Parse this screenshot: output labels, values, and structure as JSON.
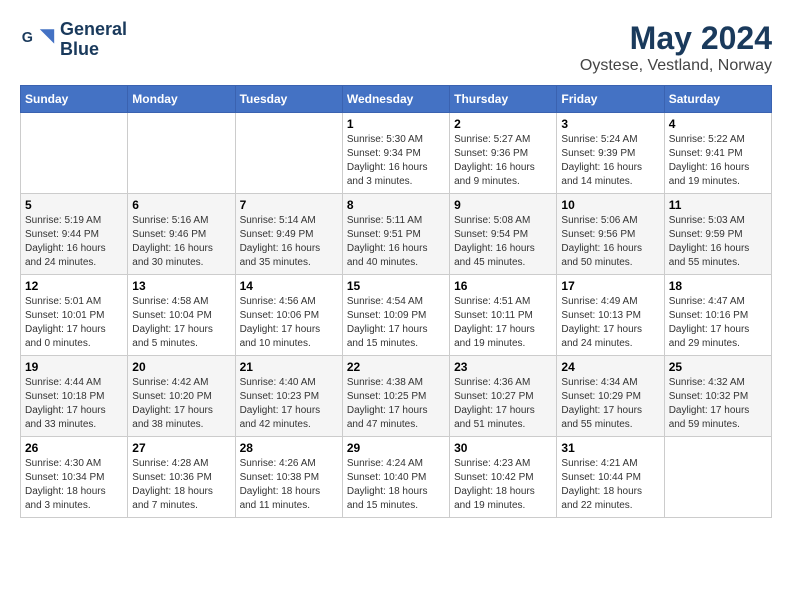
{
  "header": {
    "logo_line1": "General",
    "logo_line2": "Blue",
    "title": "May 2024",
    "subtitle": "Oystese, Vestland, Norway"
  },
  "weekdays": [
    "Sunday",
    "Monday",
    "Tuesday",
    "Wednesday",
    "Thursday",
    "Friday",
    "Saturday"
  ],
  "weeks": [
    [
      {
        "day": "",
        "info": ""
      },
      {
        "day": "",
        "info": ""
      },
      {
        "day": "",
        "info": ""
      },
      {
        "day": "1",
        "info": "Sunrise: 5:30 AM\nSunset: 9:34 PM\nDaylight: 16 hours\nand 3 minutes."
      },
      {
        "day": "2",
        "info": "Sunrise: 5:27 AM\nSunset: 9:36 PM\nDaylight: 16 hours\nand 9 minutes."
      },
      {
        "day": "3",
        "info": "Sunrise: 5:24 AM\nSunset: 9:39 PM\nDaylight: 16 hours\nand 14 minutes."
      },
      {
        "day": "4",
        "info": "Sunrise: 5:22 AM\nSunset: 9:41 PM\nDaylight: 16 hours\nand 19 minutes."
      }
    ],
    [
      {
        "day": "5",
        "info": "Sunrise: 5:19 AM\nSunset: 9:44 PM\nDaylight: 16 hours\nand 24 minutes."
      },
      {
        "day": "6",
        "info": "Sunrise: 5:16 AM\nSunset: 9:46 PM\nDaylight: 16 hours\nand 30 minutes."
      },
      {
        "day": "7",
        "info": "Sunrise: 5:14 AM\nSunset: 9:49 PM\nDaylight: 16 hours\nand 35 minutes."
      },
      {
        "day": "8",
        "info": "Sunrise: 5:11 AM\nSunset: 9:51 PM\nDaylight: 16 hours\nand 40 minutes."
      },
      {
        "day": "9",
        "info": "Sunrise: 5:08 AM\nSunset: 9:54 PM\nDaylight: 16 hours\nand 45 minutes."
      },
      {
        "day": "10",
        "info": "Sunrise: 5:06 AM\nSunset: 9:56 PM\nDaylight: 16 hours\nand 50 minutes."
      },
      {
        "day": "11",
        "info": "Sunrise: 5:03 AM\nSunset: 9:59 PM\nDaylight: 16 hours\nand 55 minutes."
      }
    ],
    [
      {
        "day": "12",
        "info": "Sunrise: 5:01 AM\nSunset: 10:01 PM\nDaylight: 17 hours\nand 0 minutes."
      },
      {
        "day": "13",
        "info": "Sunrise: 4:58 AM\nSunset: 10:04 PM\nDaylight: 17 hours\nand 5 minutes."
      },
      {
        "day": "14",
        "info": "Sunrise: 4:56 AM\nSunset: 10:06 PM\nDaylight: 17 hours\nand 10 minutes."
      },
      {
        "day": "15",
        "info": "Sunrise: 4:54 AM\nSunset: 10:09 PM\nDaylight: 17 hours\nand 15 minutes."
      },
      {
        "day": "16",
        "info": "Sunrise: 4:51 AM\nSunset: 10:11 PM\nDaylight: 17 hours\nand 19 minutes."
      },
      {
        "day": "17",
        "info": "Sunrise: 4:49 AM\nSunset: 10:13 PM\nDaylight: 17 hours\nand 24 minutes."
      },
      {
        "day": "18",
        "info": "Sunrise: 4:47 AM\nSunset: 10:16 PM\nDaylight: 17 hours\nand 29 minutes."
      }
    ],
    [
      {
        "day": "19",
        "info": "Sunrise: 4:44 AM\nSunset: 10:18 PM\nDaylight: 17 hours\nand 33 minutes."
      },
      {
        "day": "20",
        "info": "Sunrise: 4:42 AM\nSunset: 10:20 PM\nDaylight: 17 hours\nand 38 minutes."
      },
      {
        "day": "21",
        "info": "Sunrise: 4:40 AM\nSunset: 10:23 PM\nDaylight: 17 hours\nand 42 minutes."
      },
      {
        "day": "22",
        "info": "Sunrise: 4:38 AM\nSunset: 10:25 PM\nDaylight: 17 hours\nand 47 minutes."
      },
      {
        "day": "23",
        "info": "Sunrise: 4:36 AM\nSunset: 10:27 PM\nDaylight: 17 hours\nand 51 minutes."
      },
      {
        "day": "24",
        "info": "Sunrise: 4:34 AM\nSunset: 10:29 PM\nDaylight: 17 hours\nand 55 minutes."
      },
      {
        "day": "25",
        "info": "Sunrise: 4:32 AM\nSunset: 10:32 PM\nDaylight: 17 hours\nand 59 minutes."
      }
    ],
    [
      {
        "day": "26",
        "info": "Sunrise: 4:30 AM\nSunset: 10:34 PM\nDaylight: 18 hours\nand 3 minutes."
      },
      {
        "day": "27",
        "info": "Sunrise: 4:28 AM\nSunset: 10:36 PM\nDaylight: 18 hours\nand 7 minutes."
      },
      {
        "day": "28",
        "info": "Sunrise: 4:26 AM\nSunset: 10:38 PM\nDaylight: 18 hours\nand 11 minutes."
      },
      {
        "day": "29",
        "info": "Sunrise: 4:24 AM\nSunset: 10:40 PM\nDaylight: 18 hours\nand 15 minutes."
      },
      {
        "day": "30",
        "info": "Sunrise: 4:23 AM\nSunset: 10:42 PM\nDaylight: 18 hours\nand 19 minutes."
      },
      {
        "day": "31",
        "info": "Sunrise: 4:21 AM\nSunset: 10:44 PM\nDaylight: 18 hours\nand 22 minutes."
      },
      {
        "day": "",
        "info": ""
      }
    ]
  ]
}
